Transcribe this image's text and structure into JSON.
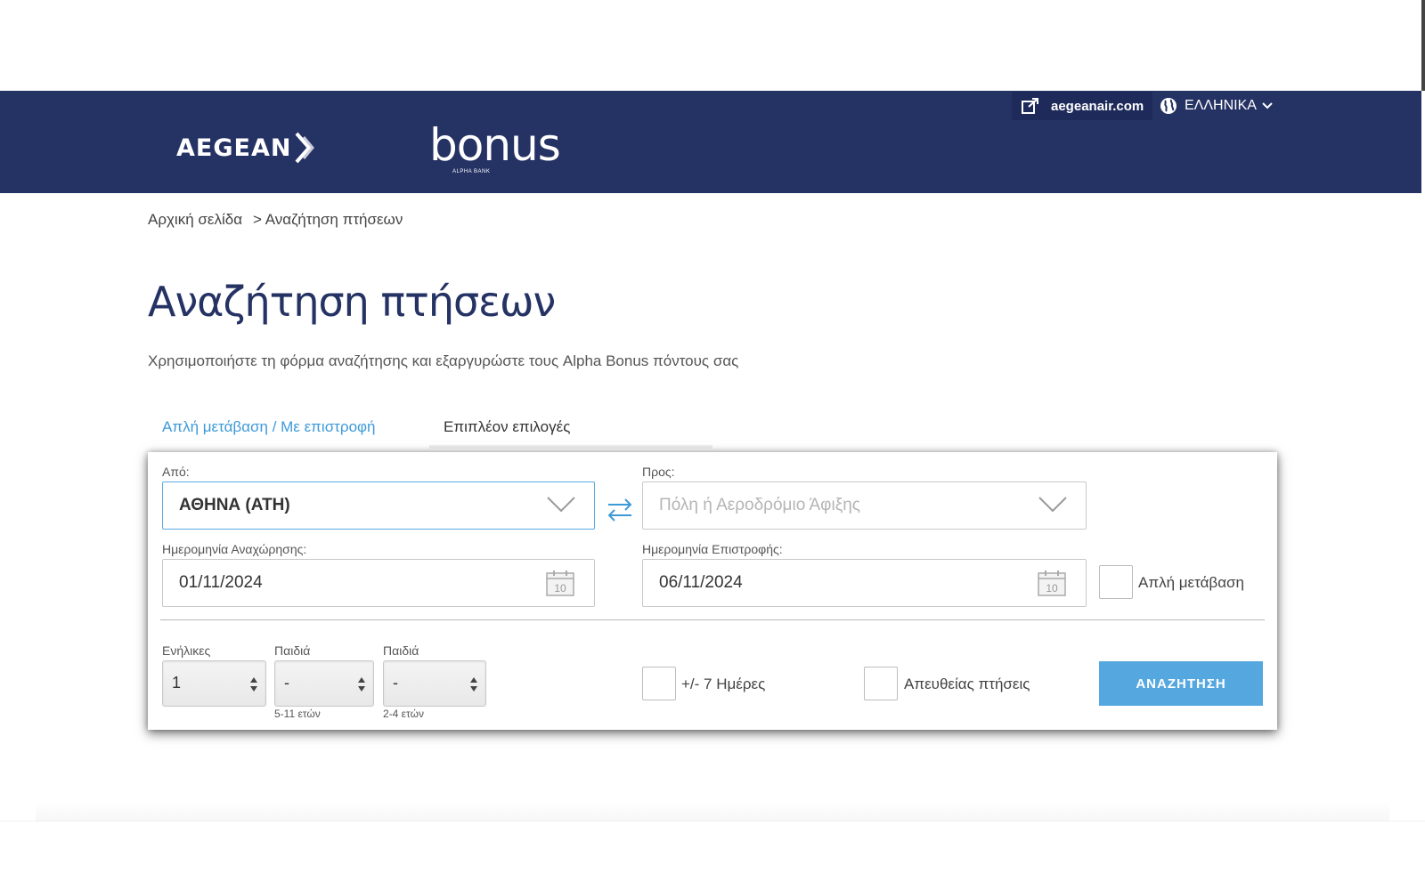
{
  "header": {
    "aegean_logo_text": "AEGEAN",
    "bonus_logo_text": "bonus",
    "bonus_logo_sub": "ALPHA BANK",
    "external_link_label": "aegeanair.com",
    "language_label": "ΕΛΛΗΝΙΚΑ"
  },
  "breadcrumb": {
    "home": "Αρχική σελίδα",
    "current": "> Αναζήτηση πτήσεων"
  },
  "page": {
    "title": "Αναζήτηση πτήσεων",
    "subtitle": "Χρησιμοποιήστε τη φόρμα αναζήτησης και εξαργυρώστε τους Alpha Bonus πόντους σας"
  },
  "tabs": [
    {
      "label": "Απλή μετάβαση / Με επιστροφή",
      "active": true
    },
    {
      "label": "Επιπλέον επιλογές",
      "active": false
    }
  ],
  "form": {
    "from_label": "Από:",
    "from_value": "ΑΘΗΝΑ (ATH)",
    "to_label": "Προς:",
    "to_placeholder": "Πόλη ή Αεροδρόμιο Άφιξης",
    "depart_label": "Ημερομηνία Αναχώρησης:",
    "depart_value": "01/11/2024",
    "return_label": "Ημερομηνία Επιστροφής:",
    "return_value": "06/11/2024",
    "calendar_day": "10",
    "one_way_label": "Απλή μετάβαση",
    "adults_label": "Ενήλικες",
    "adults_value": "1",
    "children_label": "Παιδιά",
    "children_value": "-",
    "children_age": "5-11 ετών",
    "infants_label": "Παιδιά",
    "infants_value": "-",
    "infants_age": "2-4 ετών",
    "flex_days_label": "+/- 7 Ημέρες",
    "direct_label": "Απευθείας πτήσεις",
    "search_button": "ΑΝΑΖΗΤΗΣΗ"
  },
  "colors": {
    "navy": "#253264",
    "accent_blue": "#55a7e0"
  }
}
